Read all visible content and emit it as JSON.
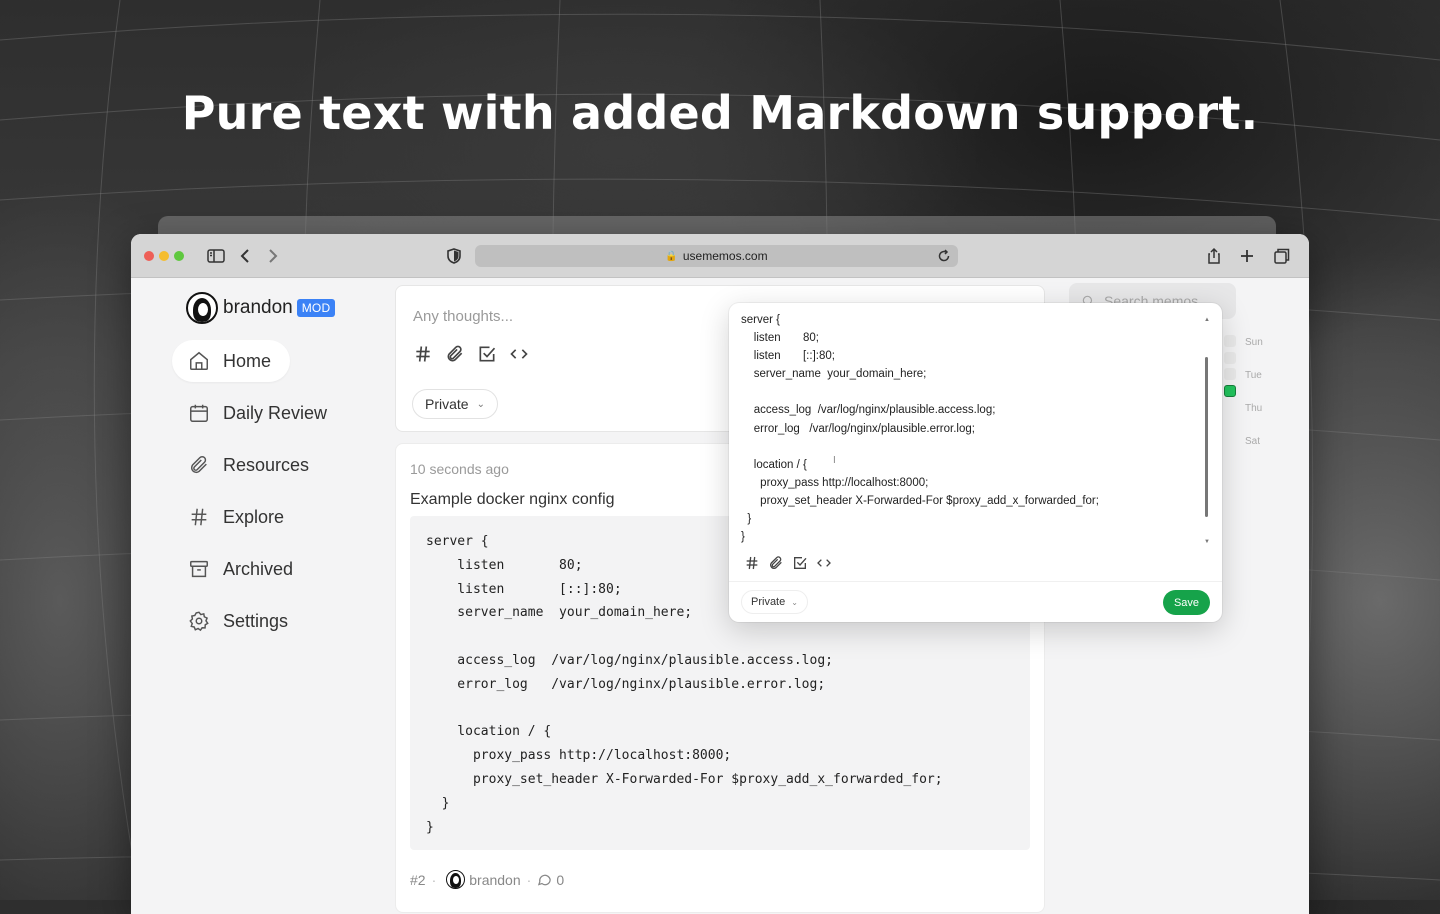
{
  "headline": "Pure text with added Markdown support.",
  "browser": {
    "url": "usememos.com",
    "traffic_colors": [
      "#ee5f57",
      "#f5bd2f",
      "#5fc83f"
    ]
  },
  "sidebar": {
    "username": "brandon",
    "badge": "MOD",
    "items": [
      {
        "label": "Home",
        "icon": "home-icon"
      },
      {
        "label": "Daily Review",
        "icon": "calendar-icon"
      },
      {
        "label": "Resources",
        "icon": "paperclip-icon"
      },
      {
        "label": "Explore",
        "icon": "hash-icon"
      },
      {
        "label": "Archived",
        "icon": "archive-icon"
      },
      {
        "label": "Settings",
        "icon": "gear-icon"
      }
    ]
  },
  "composer": {
    "placeholder": "Any thoughts...",
    "visibility": "Private"
  },
  "memo": {
    "time": "10 seconds ago",
    "title": "Example docker nginx config",
    "code_lines": [
      "server {",
      "    listen       80;",
      "    listen       [::]:80;",
      "    server_name  your_domain_here;",
      "",
      "    access_log  /var/log/nginx/plausible.access.log;",
      "    error_log   /var/log/nginx/plausible.error.log;",
      "",
      "    location / {",
      "      proxy_pass http://localhost:8000;",
      "      proxy_set_header X-Forwarded-For $proxy_add_x_forwarded_for;",
      "  }",
      "}"
    ],
    "id": "#2",
    "author": "brandon",
    "comments": "0"
  },
  "right_panel": {
    "search_placeholder": "Search memos",
    "days": [
      "Sun",
      "Tue",
      "Thu",
      "Sat"
    ],
    "accent": "#22c55e"
  },
  "editor_popover": {
    "lines": [
      "server {",
      "    listen       80;",
      "    listen       [::]:80;",
      "    server_name  your_domain_here;",
      "",
      "    access_log  /var/log/nginx/plausible.access.log;",
      "    error_log   /var/log/nginx/plausible.error.log;",
      "",
      "    location / {",
      "      proxy_pass http://localhost:8000;",
      "      proxy_set_header X-Forwarded-For $proxy_add_x_forwarded_for;",
      "  }",
      "}"
    ],
    "visibility": "Private",
    "save_label": "Save",
    "save_color": "#16a34a"
  }
}
